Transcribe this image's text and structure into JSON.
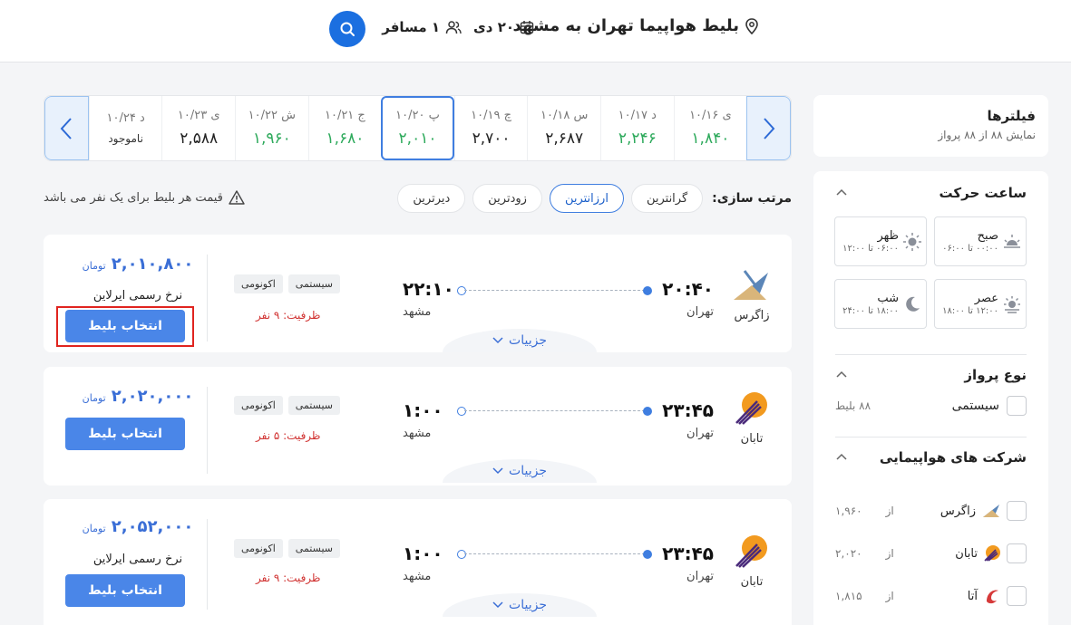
{
  "search": {
    "route": "بلیط هواپیما تهران به مشهد",
    "date": "۲۰ دی",
    "passengers": "۱ مسافر"
  },
  "filters": {
    "title": "فیلترها",
    "subtitle": "نمایش ۸۸ از ۸۸ پرواز",
    "departure_time": {
      "title": "ساعت حرکت",
      "slots": [
        {
          "label": "صبح",
          "range": "۰۰:۰۰ تا ۰۶:۰۰",
          "icon": "sunrise-icon"
        },
        {
          "label": "ظهر",
          "range": "۰۶:۰۰ تا ۱۲:۰۰",
          "icon": "sun-icon"
        },
        {
          "label": "عصر",
          "range": "۱۲:۰۰ تا ۱۸:۰۰",
          "icon": "sunset-icon"
        },
        {
          "label": "شب",
          "range": "۱۸:۰۰ تا ۲۴:۰۰",
          "icon": "moon-icon"
        }
      ]
    },
    "flight_type": {
      "title": "نوع پرواز",
      "options": [
        {
          "name": "سیستمی",
          "count": "۸۸ بلیط"
        }
      ]
    },
    "airlines": {
      "title": "شرکت های هواپیمایی",
      "items": [
        {
          "name": "زاگرس",
          "from": "از",
          "price": "۱,۹۶۰"
        },
        {
          "name": "تابان",
          "from": "از",
          "price": "۲,۰۲۰"
        },
        {
          "name": "آتا",
          "from": "از",
          "price": "۱,۸۱۵"
        }
      ]
    }
  },
  "date_strip": {
    "days": [
      {
        "label": "ی ۱۰/۱۶",
        "price": "۱,۸۴۰",
        "cheap": true
      },
      {
        "label": "د ۱۰/۱۷",
        "price": "۲,۲۴۶",
        "cheap": true
      },
      {
        "label": "س ۱۰/۱۸",
        "price": "۲,۶۸۷",
        "cheap": false
      },
      {
        "label": "چ ۱۰/۱۹",
        "price": "۲,۷۰۰",
        "cheap": false
      },
      {
        "label": "پ ۱۰/۲۰",
        "price": "۲,۰۱۰",
        "cheap": true,
        "active": true
      },
      {
        "label": "ج ۱۰/۲۱",
        "price": "۱,۶۸۰",
        "cheap": true
      },
      {
        "label": "ش ۱۰/۲۲",
        "price": "۱,۹۶۰",
        "cheap": true
      },
      {
        "label": "ی ۱۰/۲۳",
        "price": "۲,۵۸۸",
        "cheap": false
      },
      {
        "label": "د ۱۰/۲۴",
        "price": "ناموجود",
        "unavailable": true
      }
    ]
  },
  "sort": {
    "label": "مرتب سازی:",
    "options": [
      "گرانترین",
      "ارزانترین",
      "زودترین",
      "دیرترین"
    ],
    "active_index": 1,
    "note": "قیمت هر بلیط برای یک نفر می باشد"
  },
  "flights": [
    {
      "airline": "زاگرس",
      "dep_time": "۲۰:۴۰",
      "dep_city": "تهران",
      "arr_time": "۲۲:۱۰",
      "arr_city": "مشهد",
      "tags": [
        "سیستمی",
        "اکونومی"
      ],
      "capacity": "ظرفیت: ۹ نفر",
      "price": "۲,۰۱۰,۸۰۰",
      "currency": "تومان",
      "official": "نرخ رسمی ایرلاین",
      "select": "انتخاب بلیط",
      "details": "جزییات"
    },
    {
      "airline": "تابان",
      "dep_time": "۲۳:۴۵",
      "dep_city": "تهران",
      "arr_time": "۱:۰۰",
      "arr_city": "مشهد",
      "tags": [
        "سیستمی",
        "اکونومی"
      ],
      "capacity": "ظرفیت: ۵ نفر",
      "price": "۲,۰۲۰,۰۰۰",
      "currency": "تومان",
      "official": "",
      "select": "انتخاب بلیط",
      "details": "جزییات"
    },
    {
      "airline": "تابان",
      "dep_time": "۲۳:۴۵",
      "dep_city": "تهران",
      "arr_time": "۱:۰۰",
      "arr_city": "مشهد",
      "tags": [
        "سیستمی",
        "اکونومی"
      ],
      "capacity": "ظرفیت: ۹ نفر",
      "price": "۲,۰۵۲,۰۰۰",
      "currency": "تومان",
      "official": "نرخ رسمی ایرلاین",
      "select": "انتخاب بلیط",
      "details": "جزییات"
    }
  ],
  "colors": {
    "accent": "#3a6ed6",
    "cheap": "#2eaa5c",
    "warning": "#d0302f",
    "highlight": "#e0241f"
  }
}
